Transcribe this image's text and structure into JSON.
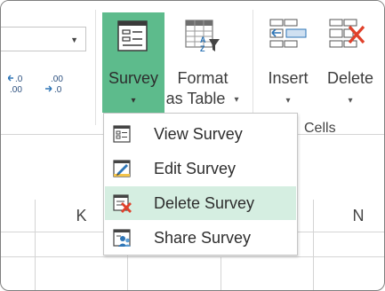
{
  "ribbon": {
    "font_size_combo": {
      "value": ""
    },
    "increase_decimal_label": ".0\n.00",
    "decrease_decimal_label": ".00\n.0",
    "buttons": {
      "survey": {
        "label": "Survey",
        "dropdown": "▾"
      },
      "format_as_table": {
        "label_line1": "Format",
        "label_line2": "as Table",
        "dropdown": "▾"
      },
      "insert": {
        "label": "Insert",
        "dropdown": "▾"
      },
      "delete": {
        "label": "Delete",
        "dropdown": "▾"
      }
    },
    "cells_group_label": "Cells"
  },
  "survey_menu": {
    "items": [
      {
        "label": "View Survey",
        "icon": "view-survey-icon",
        "highlighted": false
      },
      {
        "label": "Edit Survey",
        "icon": "edit-survey-icon",
        "highlighted": false
      },
      {
        "label": "Delete Survey",
        "icon": "delete-survey-icon",
        "highlighted": true
      },
      {
        "label": "Share Survey",
        "icon": "share-survey-icon",
        "highlighted": false
      }
    ]
  },
  "sheet": {
    "column_headers": [
      "K",
      "N"
    ]
  },
  "colors": {
    "survey_button_active": "#5dbb8c",
    "menu_highlight": "#d5eee1",
    "delete_red": "#e0412b",
    "icon_blue": "#2e75b6"
  }
}
